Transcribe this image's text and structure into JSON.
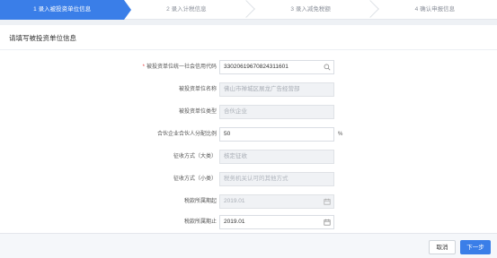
{
  "steps": [
    {
      "label": "1 录入被投资单位信息",
      "active": true
    },
    {
      "label": "2 录入计税信息",
      "active": false
    },
    {
      "label": "3 录入减免税额",
      "active": false
    },
    {
      "label": "4 确认申报信息",
      "active": false
    }
  ],
  "panel": {
    "title": "请填写被投资单位信息"
  },
  "form": {
    "credit_code": {
      "label": "被投资单位统一社会信用代码",
      "required_mark": "*",
      "value": "330206196708243116​01"
    },
    "unit_name": {
      "label": "被投资单位名称",
      "value": "佛山市禅城区展龙广告经营部"
    },
    "unit_type": {
      "label": "被投资单位类型",
      "value": "合伙企业"
    },
    "ratio": {
      "label": "合伙企业合伙人分配比例",
      "value": "50",
      "unit": "%"
    },
    "levy_major": {
      "label": "征收方式（大类）",
      "value": "核定征收"
    },
    "levy_minor": {
      "label": "征收方式（小类）",
      "placeholder": "税务机关认可的其他方式"
    },
    "period_start": {
      "label": "税款所属期起",
      "value": "2019.01"
    },
    "period_end": {
      "label": "税款所属期止",
      "value": "2019.01"
    }
  },
  "footer": {
    "cancel_label": "取消",
    "next_label": "下一步"
  },
  "colors": {
    "accent": "#3a7ee8",
    "required": "#e4393c"
  },
  "icons": {
    "search": "search-icon",
    "calendar": "calendar-icon"
  }
}
